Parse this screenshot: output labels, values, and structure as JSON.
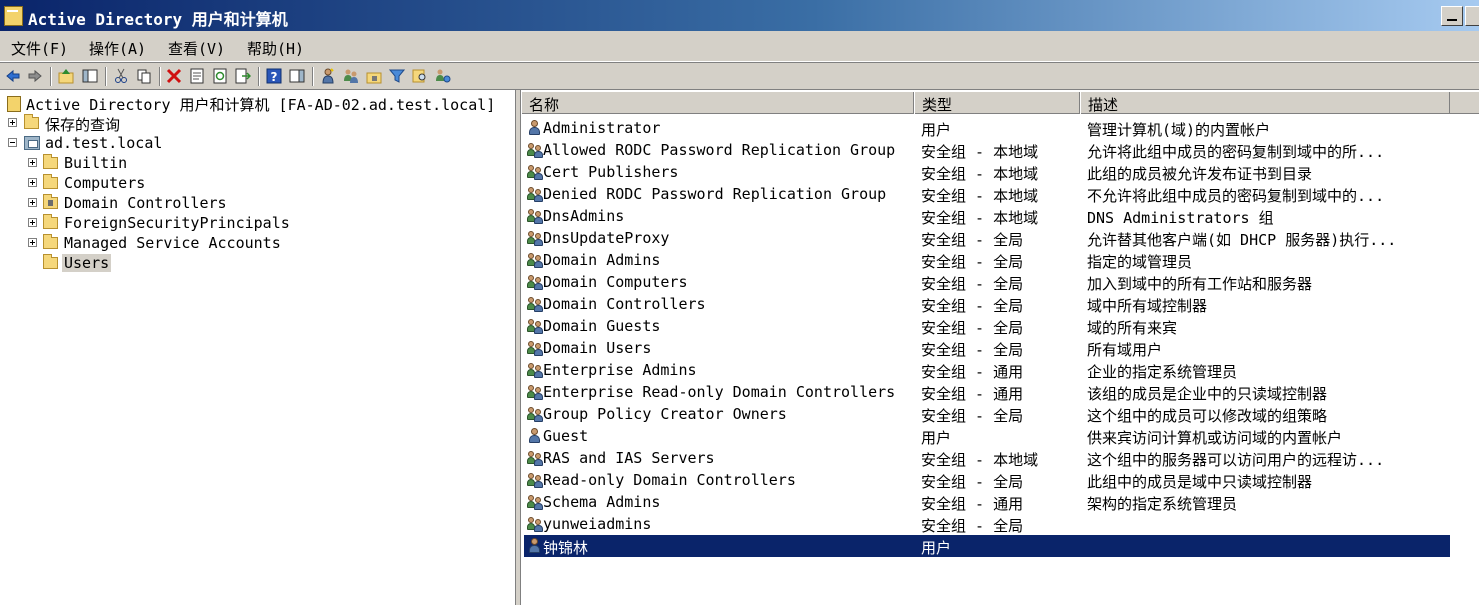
{
  "window": {
    "title": "Active Directory 用户和计算机"
  },
  "menu": [
    "文件(F)",
    "操作(A)",
    "查看(V)",
    "帮助(H)"
  ],
  "toolbar": [
    "back-icon",
    "forward-icon",
    "up-folder-icon",
    "show-hide-console-tree-icon",
    "cut-icon",
    "copy-icon",
    "delete-icon",
    "properties-icon",
    "refresh-icon",
    "export-list-icon",
    "help-icon",
    "show-hide-action-pane-icon",
    "new-user-icon",
    "new-group-icon",
    "new-ou-icon",
    "filter-icon",
    "find-icon",
    "add-to-group-icon"
  ],
  "tree": {
    "root": "Active Directory 用户和计算机 [FA-AD-02.ad.test.local]",
    "saved_queries": "保存的查询",
    "domain": "ad.test.local",
    "children": [
      "Builtin",
      "Computers",
      "Domain Controllers",
      "ForeignSecurityPrincipals",
      "Managed Service Accounts",
      "Users"
    ]
  },
  "columns": [
    "名称",
    "类型",
    "描述"
  ],
  "rows": [
    {
      "name": "Administrator",
      "type": "用户",
      "desc": "管理计算机(域)的内置帐户",
      "icon": "user"
    },
    {
      "name": "Allowed RODC Password Replication Group",
      "type": "安全组 - 本地域",
      "desc": "允许将此组中成员的密码复制到域中的所...",
      "icon": "group"
    },
    {
      "name": "Cert Publishers",
      "type": "安全组 - 本地域",
      "desc": "此组的成员被允许发布证书到目录",
      "icon": "group"
    },
    {
      "name": "Denied RODC Password Replication Group",
      "type": "安全组 - 本地域",
      "desc": "不允许将此组中成员的密码复制到域中的...",
      "icon": "group"
    },
    {
      "name": "DnsAdmins",
      "type": "安全组 - 本地域",
      "desc": "DNS Administrators 组",
      "icon": "group"
    },
    {
      "name": "DnsUpdateProxy",
      "type": "安全组 - 全局",
      "desc": "允许替其他客户端(如 DHCP 服务器)执行...",
      "icon": "group"
    },
    {
      "name": "Domain Admins",
      "type": "安全组 - 全局",
      "desc": "指定的域管理员",
      "icon": "group"
    },
    {
      "name": "Domain Computers",
      "type": "安全组 - 全局",
      "desc": "加入到域中的所有工作站和服务器",
      "icon": "group"
    },
    {
      "name": "Domain Controllers",
      "type": "安全组 - 全局",
      "desc": "域中所有域控制器",
      "icon": "group"
    },
    {
      "name": "Domain Guests",
      "type": "安全组 - 全局",
      "desc": "域的所有来宾",
      "icon": "group"
    },
    {
      "name": "Domain Users",
      "type": "安全组 - 全局",
      "desc": "所有域用户",
      "icon": "group"
    },
    {
      "name": "Enterprise Admins",
      "type": "安全组 - 通用",
      "desc": "企业的指定系统管理员",
      "icon": "group"
    },
    {
      "name": "Enterprise Read-only Domain Controllers",
      "type": "安全组 - 通用",
      "desc": "该组的成员是企业中的只读域控制器",
      "icon": "group"
    },
    {
      "name": "Group Policy Creator Owners",
      "type": "安全组 - 全局",
      "desc": "这个组中的成员可以修改域的组策略",
      "icon": "group"
    },
    {
      "name": "Guest",
      "type": "用户",
      "desc": "供来宾访问计算机或访问域的内置帐户",
      "icon": "user"
    },
    {
      "name": "RAS and IAS Servers",
      "type": "安全组 - 本地域",
      "desc": "这个组中的服务器可以访问用户的远程访...",
      "icon": "group"
    },
    {
      "name": "Read-only Domain Controllers",
      "type": "安全组 - 全局",
      "desc": "此组中的成员是域中只读域控制器",
      "icon": "group"
    },
    {
      "name": "Schema Admins",
      "type": "安全组 - 通用",
      "desc": "架构的指定系统管理员",
      "icon": "group"
    },
    {
      "name": "yunweiadmins",
      "type": "安全组 - 全局",
      "desc": "",
      "icon": "group"
    },
    {
      "name": "钟锦林",
      "type": "用户",
      "desc": "",
      "icon": "user"
    }
  ],
  "selected_row": "钟锦林",
  "selected_tree_node": "Users"
}
